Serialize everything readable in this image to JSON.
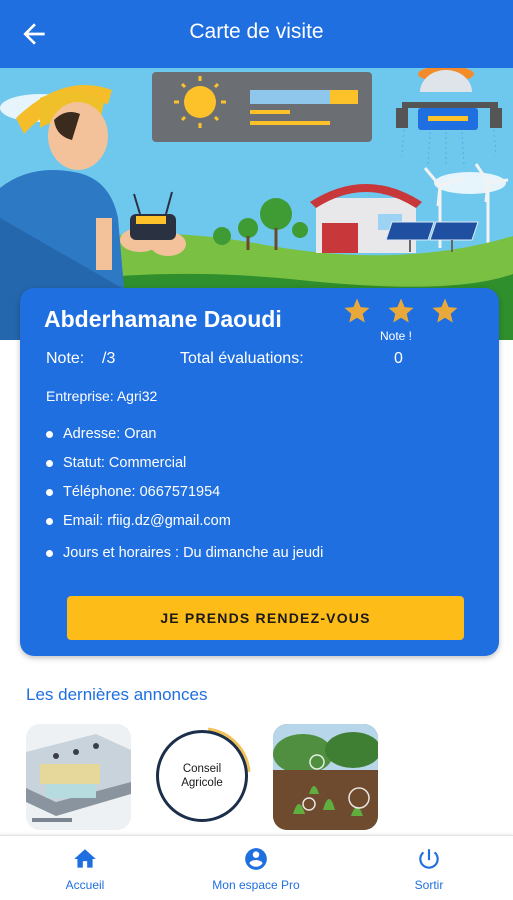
{
  "appbar": {
    "title": "Carte de visite",
    "back_icon": "arrow-left-icon"
  },
  "colors": {
    "primary": "#1f6fe0",
    "accent": "#fdbc18",
    "star": "#e8a93a"
  },
  "card": {
    "name": "Abderhamane Daoudi",
    "stars_count": 3,
    "note_link": "Note !",
    "rating_label": "Note:",
    "rating_value": "/3",
    "total_label": "Total évaluations:",
    "total_value": "0",
    "company": "Entreprise: Agri32",
    "details": [
      {
        "label": "Adresse:",
        "value": "Oran"
      },
      {
        "label": "Statut:",
        "value": "Commercial"
      },
      {
        "label": "Téléphone:",
        "value": "0667571954"
      },
      {
        "label": "Email:",
        "value": "rfiig.dz@gmail.com"
      },
      {
        "label": "Jours et horaires :",
        "value": "Du dimanche au jeudi"
      }
    ],
    "cta_label": "JE PRENDS RENDEZ-VOUS"
  },
  "latest": {
    "title": "Les dernières annonces",
    "ads": [
      {
        "kind": "image",
        "icon": "greenhouse-illustration"
      },
      {
        "kind": "logo",
        "line1": "Conseil",
        "line2": "Agricole"
      },
      {
        "kind": "image",
        "icon": "smart-farming-photo"
      }
    ]
  },
  "bottom_nav": [
    {
      "label": "Accueil",
      "icon": "home-icon"
    },
    {
      "label": "Mon espace Pro",
      "icon": "account-circle-icon"
    },
    {
      "label": "Sortir",
      "icon": "power-icon"
    }
  ]
}
